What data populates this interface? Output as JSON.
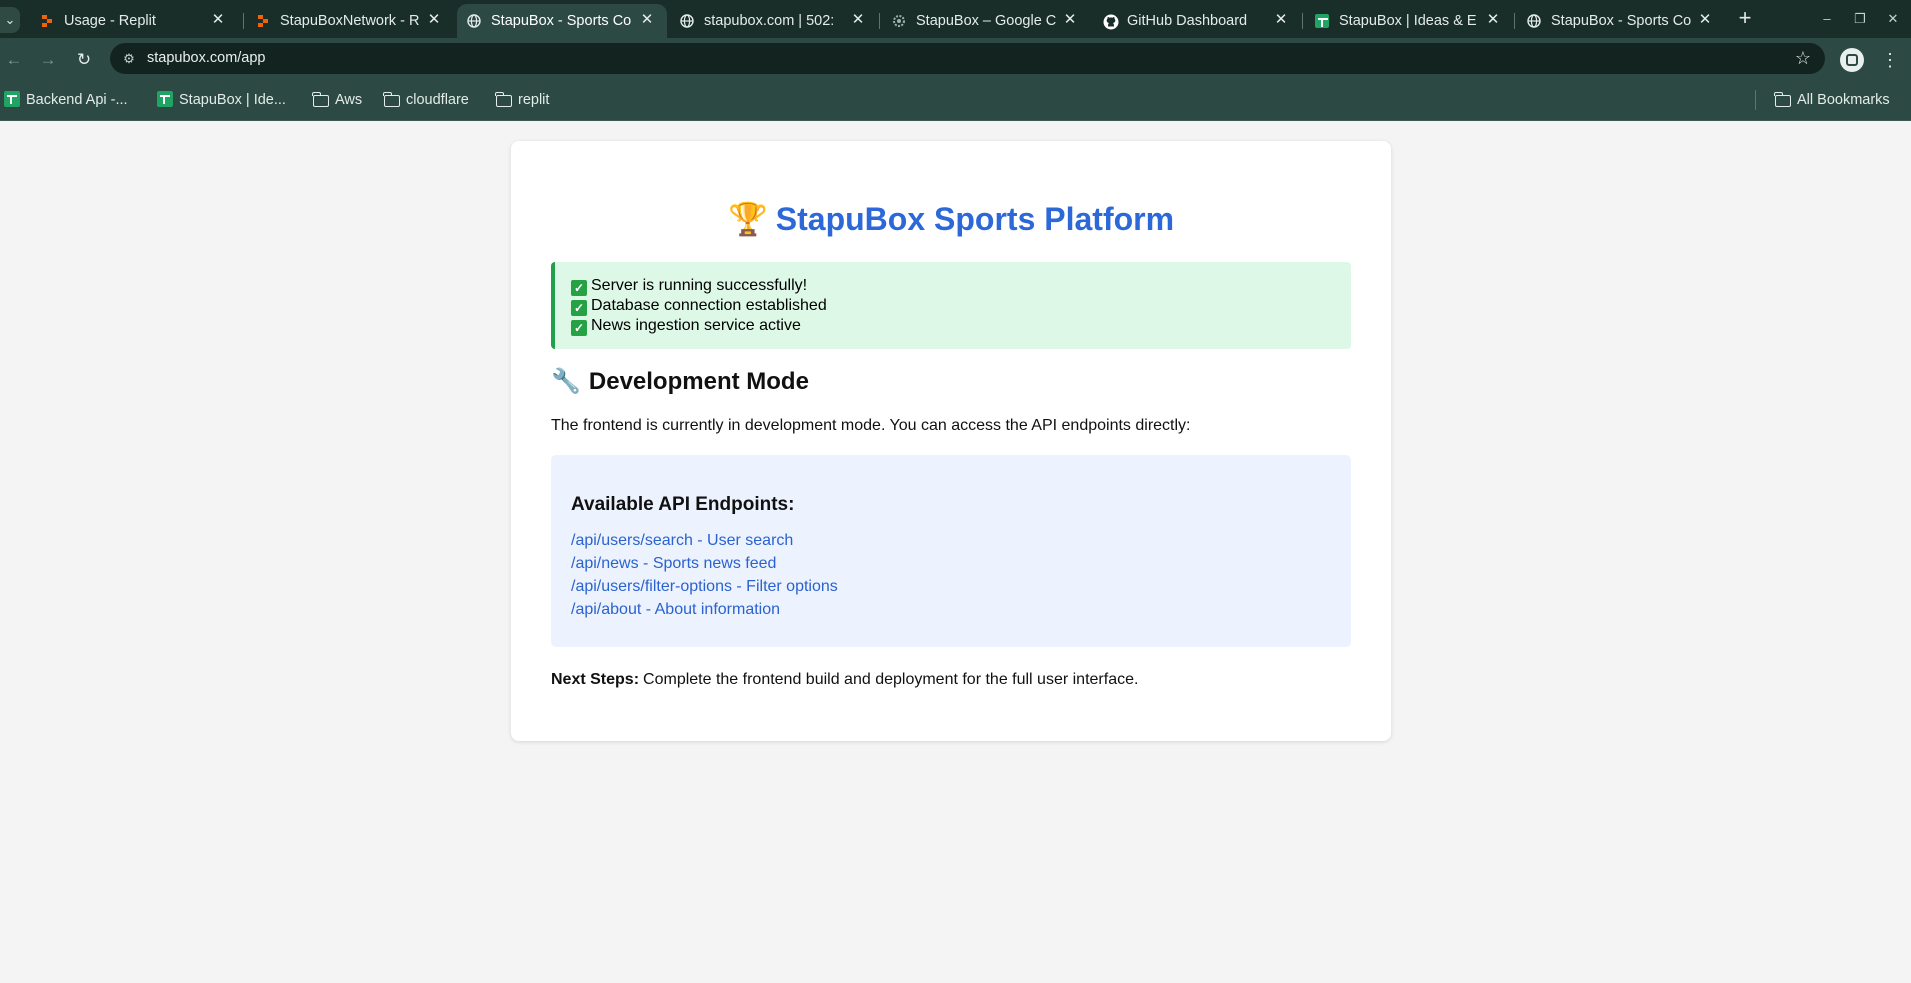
{
  "browser": {
    "tabs": [
      {
        "title": "Usage - Replit",
        "icon": "replit-icon"
      },
      {
        "title": "StapuBoxNetwork - R",
        "icon": "replit-icon"
      },
      {
        "title": "StapuBox - Sports Co",
        "icon": "globe-icon"
      },
      {
        "title": "stapubox.com | 502:",
        "icon": "globe-icon"
      },
      {
        "title": "StapuBox – Google C",
        "icon": "gear-icon"
      },
      {
        "title": "GitHub Dashboard",
        "icon": "github-icon"
      },
      {
        "title": "StapuBox | Ideas & E",
        "icon": "sheets-icon"
      },
      {
        "title": "StapuBox - Sports Co",
        "icon": "globe-icon"
      }
    ],
    "url": "stapubox.com/app",
    "bookmarks": [
      {
        "label": "Backend Api -...",
        "icon": "sheets-icon"
      },
      {
        "label": "StapuBox | Ide...",
        "icon": "sheets-icon"
      },
      {
        "label": "Aws",
        "icon": "folder-icon"
      },
      {
        "label": "cloudflare",
        "icon": "folder-icon"
      },
      {
        "label": "replit",
        "icon": "folder-icon"
      }
    ],
    "all_bookmarks": "All Bookmarks"
  },
  "page": {
    "title_emoji": "🏆",
    "title": "StapuBox Sports Platform",
    "status_lines": [
      "Server is running successfully!",
      "Database connection established",
      "News ingestion service active"
    ],
    "dev_heading_emoji": "🔧",
    "dev_heading": "Development Mode",
    "dev_text": "The frontend is currently in development mode. You can access the API endpoints directly:",
    "endpoints_title": "Available API Endpoints:",
    "endpoints": [
      "/api/users/search - User search",
      "/api/news - Sports news feed",
      "/api/users/filter-options - Filter options",
      "/api/about - About information"
    ],
    "next_steps_label": "Next Steps:",
    "next_steps_text": "Complete the frontend build and deployment for the full user interface."
  },
  "colors": {
    "accent": "#2c68d8",
    "status_bg": "#ddf8e6",
    "status_border": "#22a04b",
    "endpoints_bg": "#edf3fe",
    "chrome_dark": "#1a2e29",
    "chrome": "#2c4943"
  }
}
